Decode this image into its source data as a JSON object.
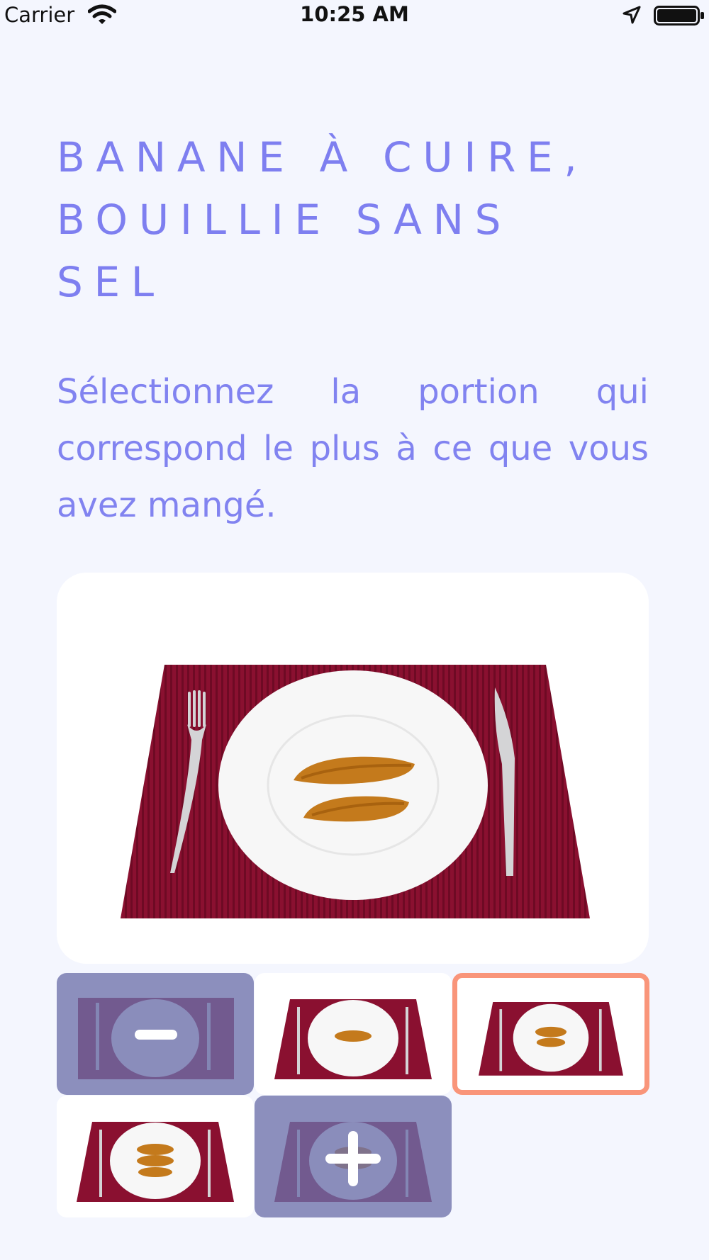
{
  "status_bar": {
    "carrier": "Carrier",
    "time": "10:25 AM",
    "wifi_icon": "wifi-icon",
    "location_icon": "location-arrow-icon",
    "battery_icon": "battery-icon"
  },
  "title": {
    "lines": [
      "BANANE À CUIRE,",
      "BOUILLIE SANS",
      "SEL"
    ]
  },
  "instruction": "Sélectionnez la portion qui correspond le plus à ce que vous avez mangé.",
  "colors": {
    "accent": "#7e7ff0",
    "background": "#f4f6fe",
    "selected_border": "#f9957a",
    "control_overlay": "#6c70aa"
  },
  "portions": {
    "selected_index": 1,
    "items": [
      {
        "kind": "decrease",
        "icon": "minus-icon"
      },
      {
        "kind": "portion",
        "pieces": 1
      },
      {
        "kind": "portion",
        "pieces": 2
      },
      {
        "kind": "portion",
        "pieces": 3
      },
      {
        "kind": "increase",
        "icon": "plus-icon"
      }
    ]
  }
}
